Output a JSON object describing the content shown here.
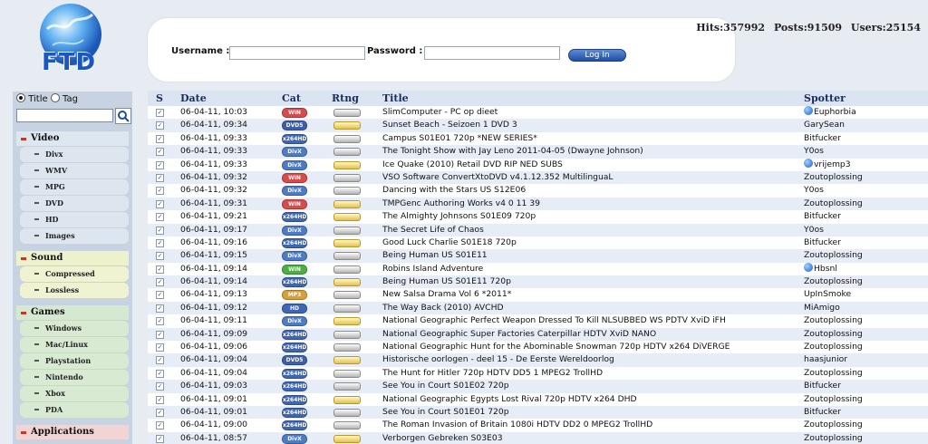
{
  "logo": {
    "text": "FTD"
  },
  "login": {
    "username_label": "Username :",
    "password_label": "Password :",
    "button": "Log In"
  },
  "stats": {
    "hits": "Hits:357992",
    "posts": "Posts:91509",
    "users": "Users:25154"
  },
  "sidebar": {
    "search_title": "Title",
    "search_tag": "Tag",
    "sections": [
      {
        "title": "Video",
        "items": [
          "Divx",
          "WMV",
          "MPG",
          "DVD",
          "HD",
          "Images"
        ]
      },
      {
        "title": "Sound",
        "items": [
          "Compressed",
          "Lossless"
        ]
      },
      {
        "title": "Games",
        "items": [
          "Windows",
          "Mac/Linux",
          "Playstation",
          "Nintendo",
          "Xbox",
          "PDA"
        ]
      },
      {
        "title": "Applications",
        "items": []
      }
    ]
  },
  "columns": {
    "s": "S",
    "date": "Date",
    "cat": "Cat",
    "rtng": "Rtng",
    "title": "Title",
    "spotter": "Spotter"
  },
  "rows": [
    {
      "date": "06-04-11, 10:03",
      "cat": "WIN",
      "title": "SlimComputer - PC op dieet",
      "spotter": "Euphorbia",
      "globe": true
    },
    {
      "date": "06-04-11, 09:34",
      "cat": "DVD5",
      "title": "Sunset Beach - Seizoen 1 DVD 3",
      "spotter": "GarySean"
    },
    {
      "date": "06-04-11, 09:33",
      "cat": "x264HD",
      "title": "Campus S01E01 720p *NEW SERIES*",
      "spotter": "Bitfucker"
    },
    {
      "date": "06-04-11, 09:33",
      "cat": "DivX",
      "title": "The Tonight Show with Jay Leno 2011-04-05 (Dwayne Johnson)",
      "spotter": "Y0os"
    },
    {
      "date": "06-04-11, 09:33",
      "cat": "DivX",
      "title": "Ice Quake (2010) Retail DVD RIP NED SUBS",
      "spotter": "vrijemp3",
      "globe": true
    },
    {
      "date": "06-04-11, 09:32",
      "cat": "WIN",
      "title": "VSO Software ConvertXtoDVD v4.1.12.352 MultilinguaL",
      "spotter": "Zoutoplossing"
    },
    {
      "date": "06-04-11, 09:32",
      "cat": "DivX",
      "title": "Dancing with the Stars US S12E06",
      "spotter": "Y0os"
    },
    {
      "date": "06-04-11, 09:31",
      "cat": "WIN",
      "title": "TMPGenc Authoring Works v4 0 11 39",
      "spotter": "Zoutoplossing"
    },
    {
      "date": "06-04-11, 09:21",
      "cat": "x264HD",
      "title": "The Almighty Johnsons S01E09 720p",
      "spotter": "Bitfucker"
    },
    {
      "date": "06-04-11, 09:17",
      "cat": "DivX",
      "title": "The Secret Life of Chaos",
      "spotter": "Y0os"
    },
    {
      "date": "06-04-11, 09:16",
      "cat": "x264HD",
      "title": "Good Luck Charlie S01E18 720p",
      "spotter": "Bitfucker"
    },
    {
      "date": "06-04-11, 09:15",
      "cat": "DivX",
      "title": "Being Human US S01E11",
      "spotter": "Zoutoplossing"
    },
    {
      "date": "06-04-11, 09:14",
      "cat": "WIN",
      "title": "Robins Island Adventure",
      "spotter": "Hbsnl",
      "globe": true,
      "green": true
    },
    {
      "date": "06-04-11, 09:14",
      "cat": "x264HD",
      "title": "Being Human US S01E11 720p",
      "spotter": "Zoutoplossing"
    },
    {
      "date": "06-04-11, 09:13",
      "cat": "MP3",
      "title": "New Salsa Drama Vol 6 *2011*",
      "spotter": "UpInSmoke"
    },
    {
      "date": "06-04-11, 09:12",
      "cat": "HD",
      "title": "The Way Back (2010) AVCHD",
      "spotter": "MiAmigo"
    },
    {
      "date": "06-04-11, 09:11",
      "cat": "DivX",
      "title": "National Geographic Perfect Weapon Dressed To Kill NLSUBBED WS PDTV XviD iFH",
      "spotter": "Zoutoplossing"
    },
    {
      "date": "06-04-11, 09:09",
      "cat": "x264HD",
      "title": "National Geographic Super Factories Caterpillar HDTV XviD NANO",
      "spotter": "Zoutoplossing"
    },
    {
      "date": "06-04-11, 09:06",
      "cat": "x264HD",
      "title": "National Geographic Hunt for the Abominable Snowman 720p HDTV x264 DiVERGE",
      "spotter": "Zoutoplossing"
    },
    {
      "date": "06-04-11, 09:04",
      "cat": "DVD5",
      "title": "Historische oorlogen - deel 15 - De Eerste Wereldoorlog",
      "spotter": "haasjunior"
    },
    {
      "date": "06-04-11, 09:04",
      "cat": "x264HD",
      "title": "The Hunt for Hitler 720p HDTV DD5 1 MPEG2 TrollHD",
      "spotter": "Zoutoplossing"
    },
    {
      "date": "06-04-11, 09:03",
      "cat": "x264HD",
      "title": "See You in Court S01E02 720p",
      "spotter": "Bitfucker"
    },
    {
      "date": "06-04-11, 09:01",
      "cat": "x264HD",
      "title": "National Geographic Egypts Lost Rival 720p HDTV x264 DHD",
      "spotter": "Zoutoplossing"
    },
    {
      "date": "06-04-11, 09:01",
      "cat": "x264HD",
      "title": "See You in Court S01E01 720p",
      "spotter": "Bitfucker"
    },
    {
      "date": "06-04-11, 09:00",
      "cat": "x264HD",
      "title": "The Roman Invasion of Britain 1080i HDTV DD2 0 MPEG2 TrollHD",
      "spotter": "Zoutoplossing"
    },
    {
      "date": "06-04-11, 08:57",
      "cat": "DivX",
      "title": "Verborgen Gebreken S03E03",
      "spotter": "Zoutoplossing"
    }
  ],
  "colors": {
    "background": "#e7ecf2",
    "row_alt": "#e6edf6",
    "header": "#dbe5f1"
  }
}
